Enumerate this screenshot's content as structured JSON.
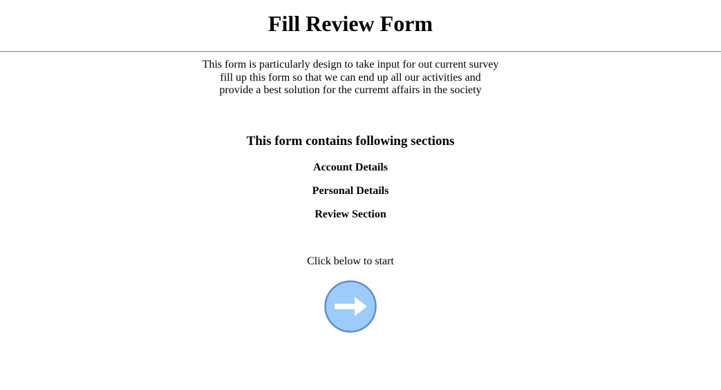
{
  "header": {
    "title": "Fill Review Form"
  },
  "intro": {
    "lines": [
      "This form is particularly design to take input for out current survey",
      "fill up this form so that we can end up all our activities and",
      "provide a best solution for the curremt affairs in the society"
    ]
  },
  "sections": {
    "heading": "This form contains following sections",
    "items": [
      "Account Details",
      "Personal Details",
      "Review Section"
    ]
  },
  "start": {
    "prompt": "Click below to start",
    "button_icon": "arrow-right-icon"
  },
  "colors": {
    "button_fill": "#9dcbfb",
    "button_border": "#5b8fd0",
    "arrow": "#ffffff",
    "divider": "#8f8f8f"
  }
}
